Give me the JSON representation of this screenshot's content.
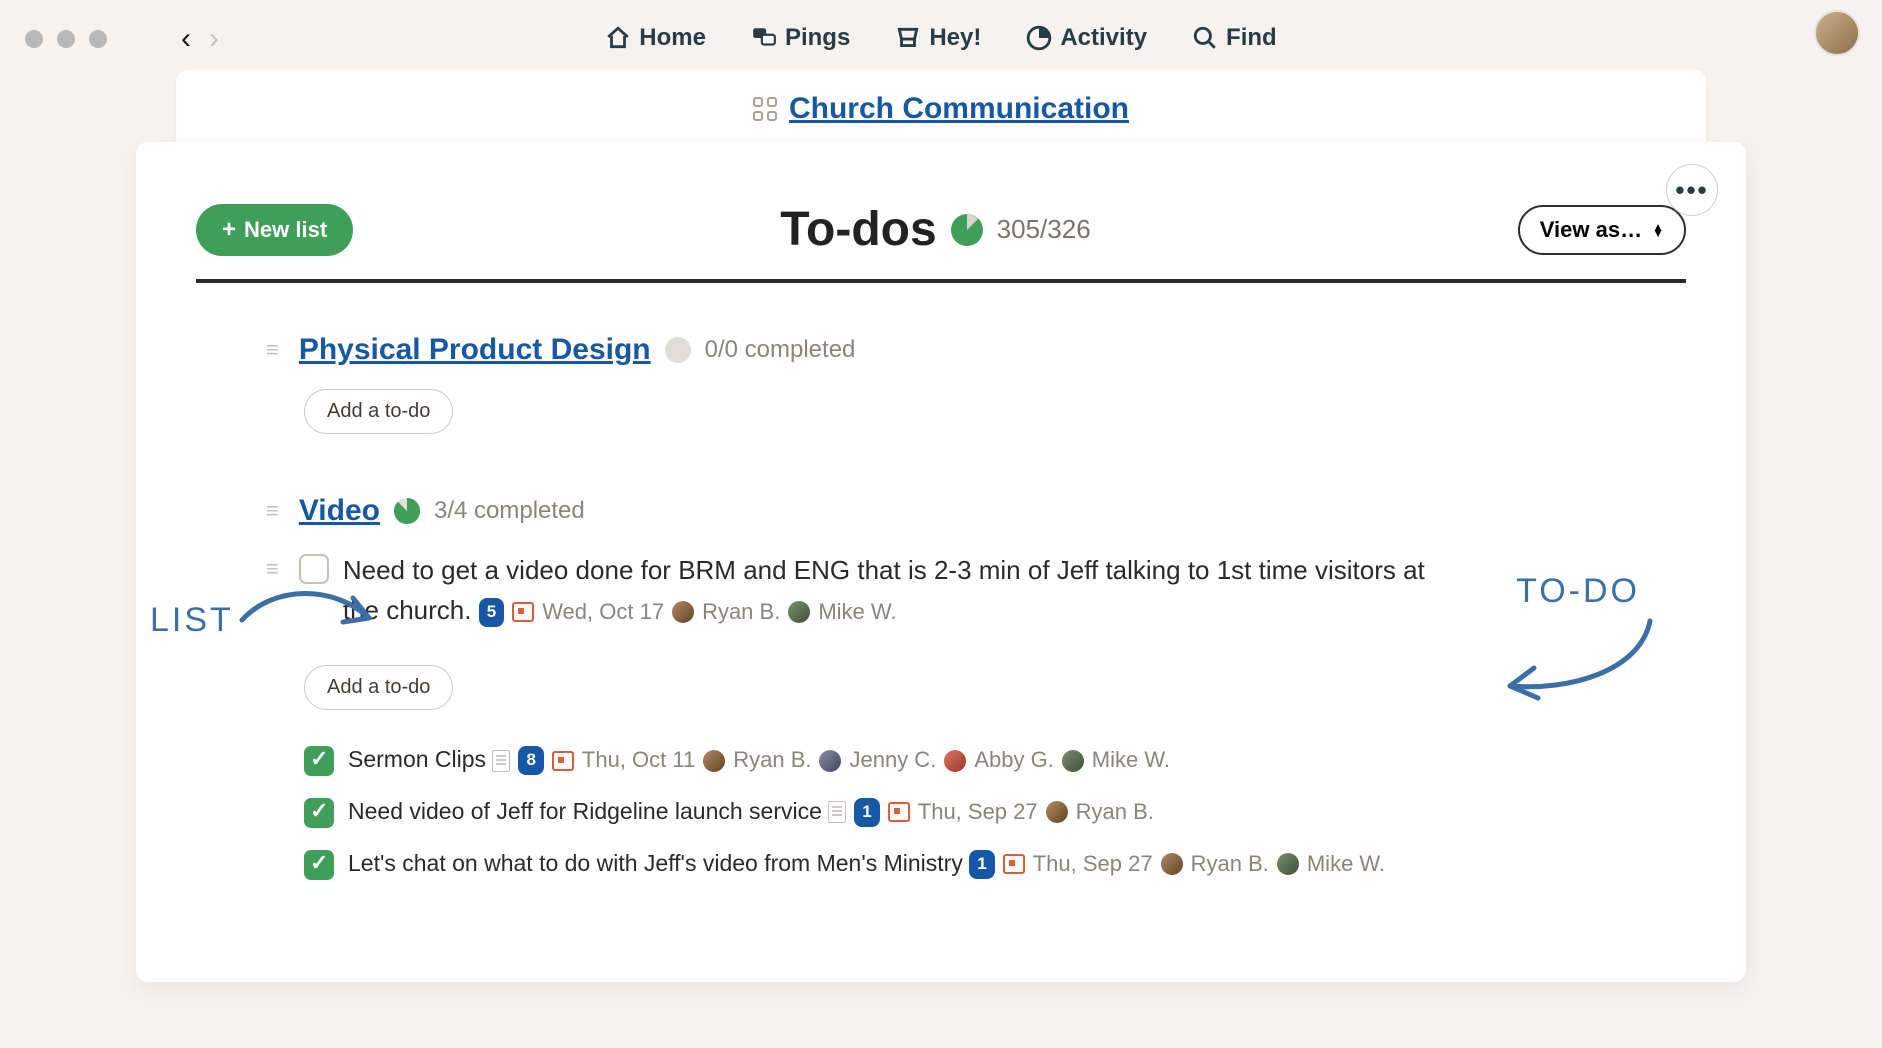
{
  "nav": {
    "home": "Home",
    "pings": "Pings",
    "hey": "Hey!",
    "activity": "Activity",
    "find": "Find"
  },
  "project": {
    "name": "Church Communication"
  },
  "page": {
    "title": "To-dos",
    "new_list_label": "New list",
    "view_as_label": "View as…",
    "count_text": "305/326",
    "completed": 305,
    "total": 326
  },
  "add_todo_label": "Add a to-do",
  "lists": [
    {
      "title": "Physical Product Design",
      "progress_text": "0/0 completed",
      "completed": 0,
      "total": 0,
      "todos": [],
      "done": []
    },
    {
      "title": "Video",
      "progress_text": "3/4 completed",
      "completed": 3,
      "total": 4,
      "todos": [
        {
          "text": "Need to get a video done for BRM and ENG that is 2-3 min of Jeff talking to 1st time visitors at the church.",
          "comment_count": "5",
          "due": "Wed, Oct 17",
          "assignees": [
            "Ryan B.",
            "Mike W."
          ]
        }
      ],
      "done": [
        {
          "text": "Sermon Clips",
          "has_doc": true,
          "comment_count": "8",
          "due": "Thu, Oct 11",
          "assignees": [
            "Ryan B.",
            "Jenny C.",
            "Abby G.",
            "Mike W."
          ]
        },
        {
          "text": "Need video of Jeff for Ridgeline launch service",
          "has_doc": true,
          "comment_count": "1",
          "due": "Thu, Sep 27",
          "assignees": [
            "Ryan B."
          ]
        },
        {
          "text": "Let's chat on what to do with Jeff's video from Men's Ministry",
          "has_doc": false,
          "comment_count": "1",
          "due": "Thu, Sep 27",
          "assignees": [
            "Ryan B.",
            "Mike W."
          ]
        }
      ]
    }
  ],
  "annotations": {
    "list": "LIST",
    "todo": "TO-DO"
  }
}
